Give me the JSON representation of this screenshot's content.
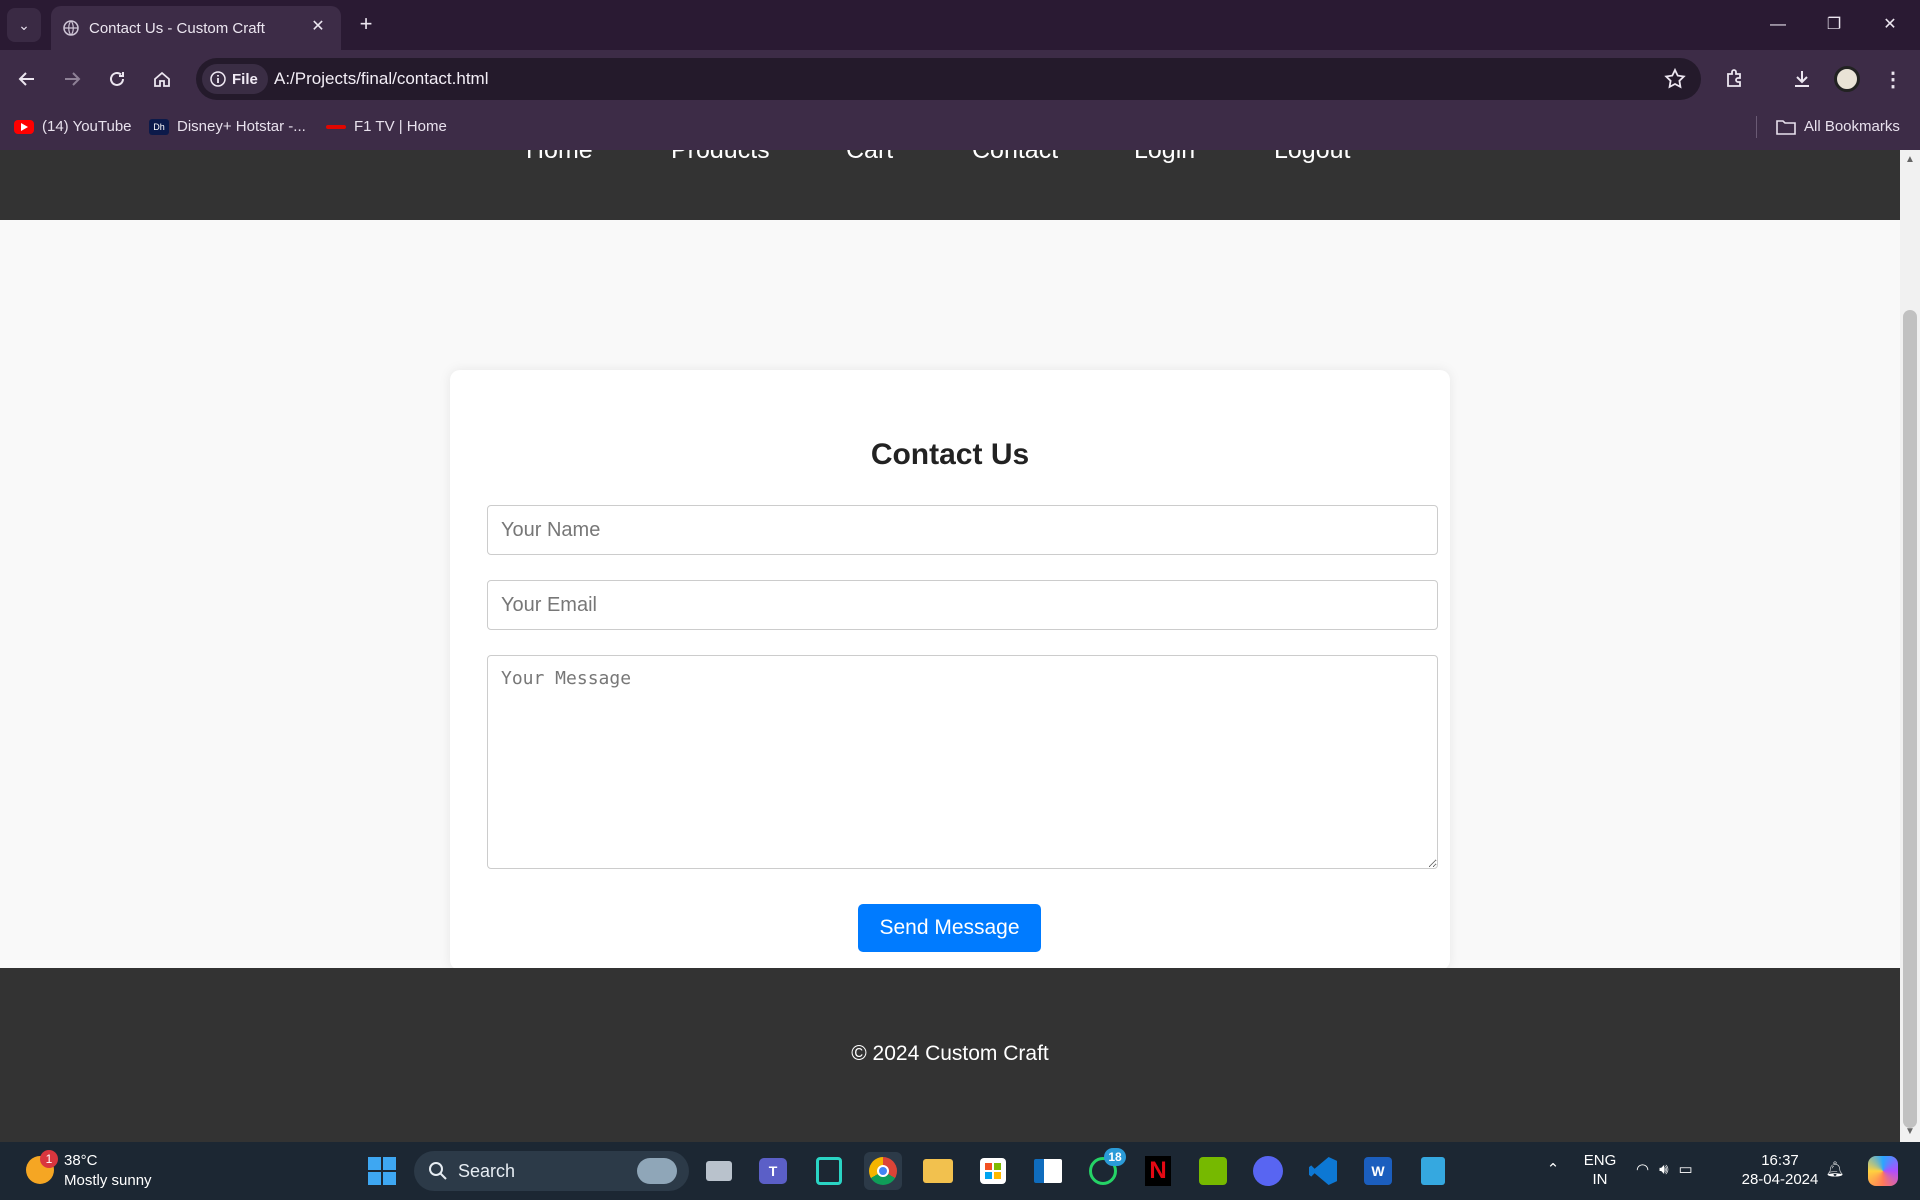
{
  "browser": {
    "tab_title": "Contact Us - Custom Craft",
    "url_chip": "File",
    "url": "A:/Projects/final/contact.html",
    "bookmarks": [
      {
        "label": "(14) YouTube",
        "icon": "youtube-icon"
      },
      {
        "label": "Disney+ Hotstar -...",
        "icon": "hotstar-icon"
      },
      {
        "label": "F1 TV | Home",
        "icon": "f1-icon"
      }
    ],
    "all_bookmarks": "All Bookmarks"
  },
  "site": {
    "nav": [
      "Home",
      "Products",
      "Cart",
      "Contact",
      "Login",
      "Logout"
    ],
    "form": {
      "heading": "Contact Us",
      "name_placeholder": "Your Name",
      "email_placeholder": "Your Email",
      "message_placeholder": "Your Message",
      "submit_label": "Send Message"
    },
    "footer": "© 2024 Custom Craft",
    "colors": {
      "nav_bg": "#333333",
      "button": "#007bff",
      "page_bg": "#f9f9f9"
    }
  },
  "taskbar": {
    "weather_temp": "38°C",
    "weather_desc": "Mostly sunny",
    "weather_badge": "1",
    "search_label": "Search",
    "whatsapp_badge": "18",
    "lang_line1": "ENG",
    "lang_line2": "IN",
    "time": "16:37",
    "date": "28-04-2024"
  }
}
